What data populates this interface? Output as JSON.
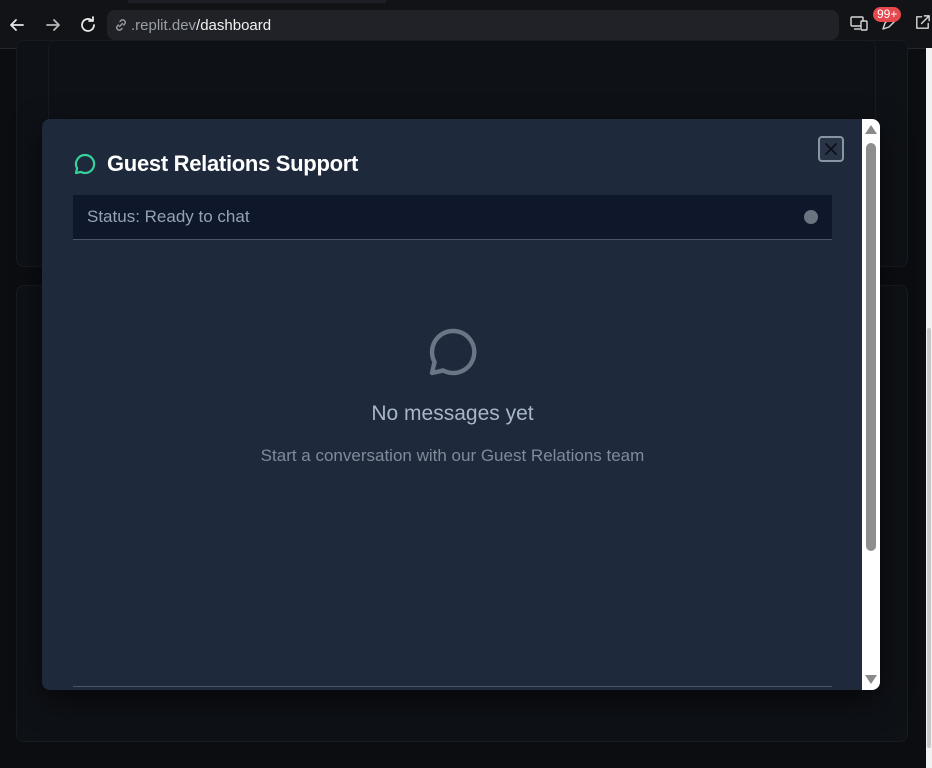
{
  "browser": {
    "url_host": ".replit.dev",
    "url_path": "/dashboard",
    "notification_badge": "99+"
  },
  "modal": {
    "title": "Guest Relations Support",
    "status": "Status: Ready to chat",
    "status_dot_color": "#6b7280",
    "empty_title": "No messages yet",
    "empty_subtitle": "Start a conversation with our Guest Relations team",
    "accent_color": "#34d399",
    "icons": {
      "title": "chat-bubble-icon",
      "empty": "chat-bubble-icon",
      "close": "close-icon"
    }
  }
}
